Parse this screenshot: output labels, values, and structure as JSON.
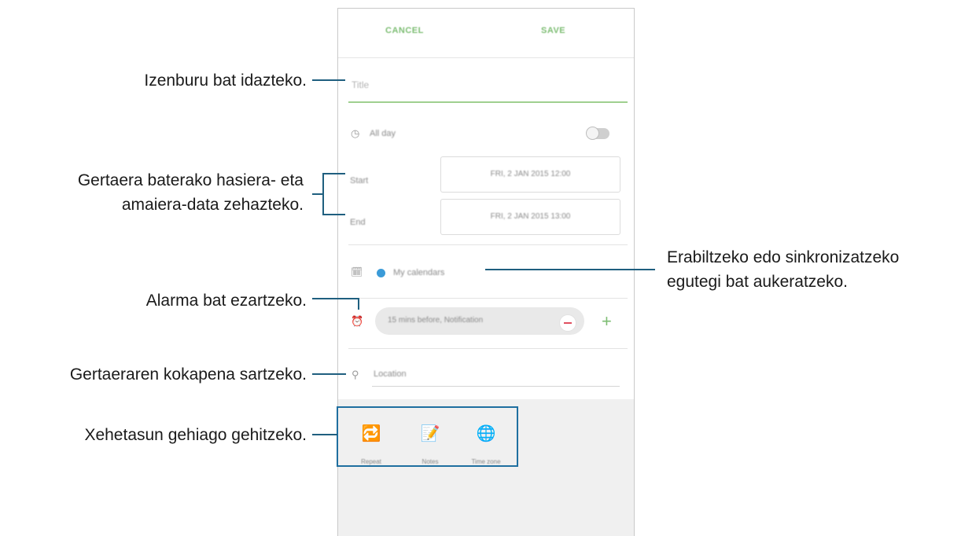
{
  "screen": {
    "topbar": {
      "cancel_label": "CANCEL",
      "save_label": "SAVE"
    },
    "title_placeholder": "Title",
    "all_day_label": "All day",
    "start_label": "Start",
    "end_label": "End",
    "start_value": "FRI, 2 JAN 2015   12:00",
    "end_value": "FRI, 2 JAN 2015   13:00",
    "calendar_label": "My calendars",
    "alarm_value": "15 mins before, Notification",
    "location_placeholder": "Location",
    "details": [
      {
        "label": "Repeat",
        "icon": "repeat-icon"
      },
      {
        "label": "Notes",
        "icon": "notes-icon"
      },
      {
        "label": "Time zone",
        "icon": "time-zone-icon"
      }
    ],
    "accent_color": "#7dbd73",
    "calendar_color": "#3b9bd8"
  },
  "annotations": {
    "title": "Izenburu bat idazteko.",
    "dates_line1": "Gertaera baterako hasiera- eta",
    "dates_line2": "amaiera-data zehazteko.",
    "calendar_line1": "Erabiltzeko edo sinkronizatzeko",
    "calendar_line2": "egutegi bat aukeratzeko.",
    "alarm": "Alarma bat ezartzeko.",
    "location": "Gertaeraren kokapena sartzeko.",
    "details": "Xehetasun gehiago gehitzeko."
  }
}
